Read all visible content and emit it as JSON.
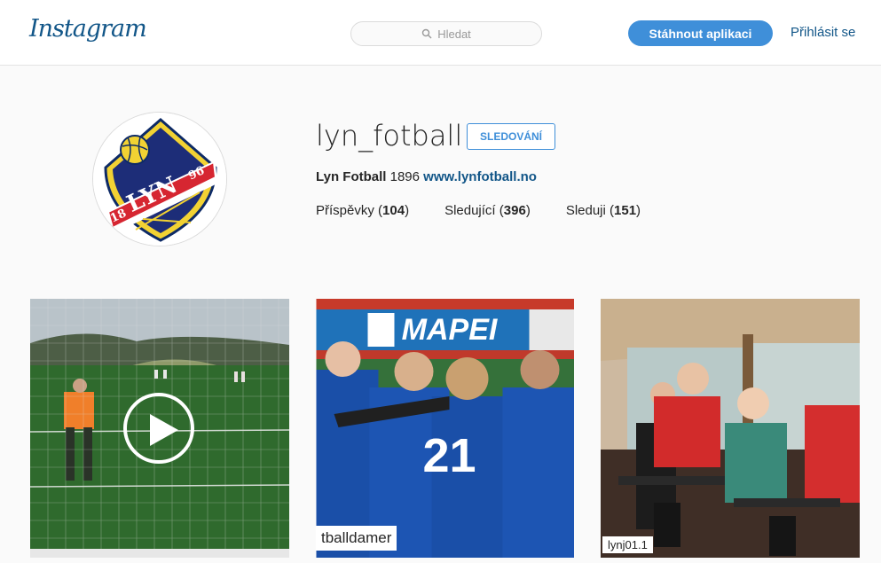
{
  "header": {
    "logo": "Instagram",
    "search_placeholder": "Hledat",
    "download_label": "Stáhnout aplikaci",
    "login_label": "Přihlásit se"
  },
  "profile": {
    "username": "lyn_fotball",
    "follow_label": "SLEDOVÁNÍ",
    "full_name": "Lyn Fotball",
    "bio_text": " 1896 ",
    "website": "www.lynfotball.no",
    "stats": {
      "posts_label": "Příspěvky",
      "posts_count": "104",
      "followers_label": "Sledující",
      "followers_count": "396",
      "following_label": "Sleduji",
      "following_count": "151"
    },
    "logo_text": "LYN",
    "logo_year_left": "18",
    "logo_year_right": "96"
  },
  "posts": [
    {
      "type": "video",
      "caption": ""
    },
    {
      "type": "photo",
      "caption": "tballdamer",
      "banner": "MAPEI",
      "jersey": "21"
    },
    {
      "type": "photo",
      "caption": "lynj01.1"
    }
  ],
  "colors": {
    "accent": "#3f8fd9",
    "link": "#125688",
    "background": "#fafafa"
  },
  "icons": {
    "search": "magnifier",
    "play": "play-triangle"
  }
}
